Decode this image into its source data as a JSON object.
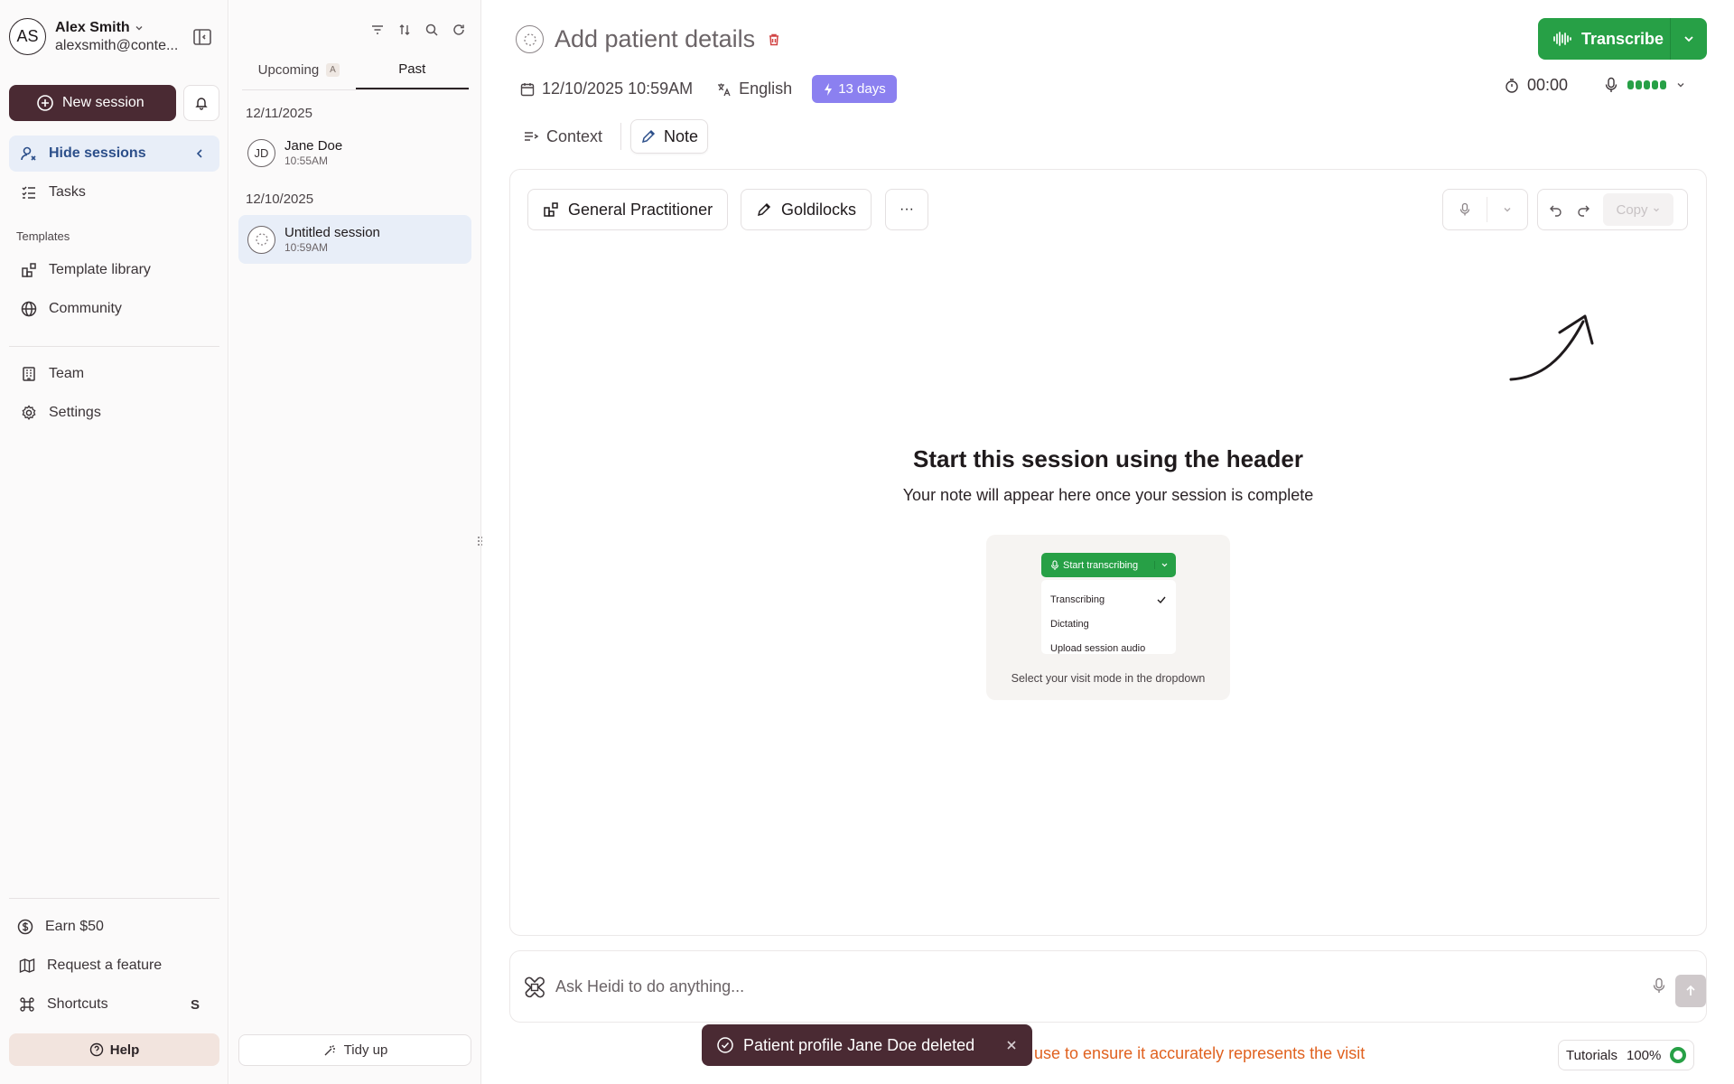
{
  "user": {
    "initials": "AS",
    "name": "Alex Smith",
    "email": "alexsmith@conte..."
  },
  "sidebar": {
    "new_session": "New session",
    "hide_sessions": "Hide sessions",
    "tasks": "Tasks",
    "templates_label": "Templates",
    "template_library": "Template library",
    "community": "Community",
    "team": "Team",
    "settings": "Settings",
    "earn": "Earn $50",
    "request_feature": "Request a feature",
    "shortcuts": "Shortcuts",
    "shortcuts_key": "S",
    "help": "Help"
  },
  "sessions": {
    "tabs": [
      {
        "label": "Upcoming",
        "badge": "A"
      },
      {
        "label": "Past"
      }
    ],
    "groups": [
      {
        "date": "12/11/2025",
        "items": [
          {
            "initials": "JD",
            "name": "Jane Doe",
            "time": "10:55AM"
          }
        ]
      },
      {
        "date": "12/10/2025",
        "items": [
          {
            "name": "Untitled session",
            "time": "10:59AM",
            "selected": true
          }
        ]
      }
    ],
    "tidy_up": "Tidy up"
  },
  "header": {
    "title": "Add patient details",
    "datetime": "12/10/2025 10:59AM",
    "language": "English",
    "days_badge": "13 days",
    "transcribe": "Transcribe",
    "timer": "00:00",
    "mic_level_bars": 5
  },
  "view_tabs": {
    "context": "Context",
    "note": "Note"
  },
  "note": {
    "template": "General Practitioner",
    "style": "Goldilocks",
    "more": "···",
    "copy": "Copy",
    "empty_title": "Start this session using the header",
    "empty_subtitle": "Your note will appear here once your session is complete",
    "preview": {
      "button": "Start transcribing",
      "options": [
        "Transcribing",
        "Dictating",
        "Upload session audio"
      ],
      "caption": "Select your visit mode in the dropdown"
    }
  },
  "ask": {
    "placeholder": "Ask Heidi to do anything..."
  },
  "disclaimer": "e use to ensure it accurately represents the visit",
  "toast": {
    "message": "Patient profile Jane Doe deleted"
  },
  "tutorials": {
    "label": "Tutorials",
    "progress": "100%"
  },
  "colors": {
    "primary": "#4a2a33",
    "accent_green": "#27a046",
    "badge_purple": "#8b80f0",
    "active_blue": "#e8eef8",
    "warning_orange": "#e0611f"
  }
}
